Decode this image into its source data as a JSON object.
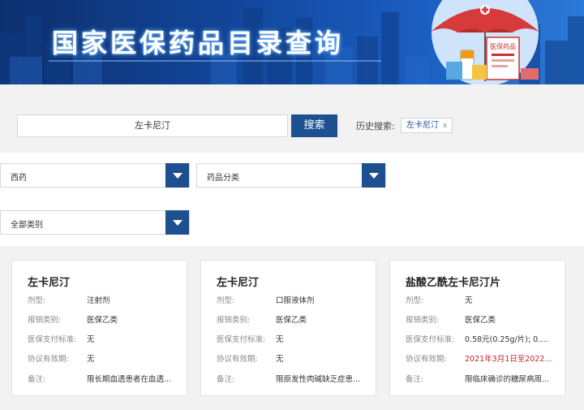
{
  "banner": {
    "title": "国家医保药品目录查询",
    "illustration_sign": "医保药品"
  },
  "search": {
    "value": "左卡尼汀",
    "button_label": "搜索",
    "history_label": "历史搜索:",
    "history_tags": [
      {
        "label": "左卡尼汀",
        "remove": "x"
      }
    ]
  },
  "filters": {
    "type_value": "西药",
    "category_value": "药品分类",
    "class_value": "全部类别"
  },
  "cards": [
    {
      "name": "左卡尼汀",
      "rows": [
        {
          "k": "剂型:",
          "v": "注射剂"
        },
        {
          "k": "报销类别:",
          "v": "医保乙类"
        },
        {
          "k": "医保支付标准:",
          "v": "无"
        },
        {
          "k": "协议有效期:",
          "v": "无"
        },
        {
          "k": "备注:",
          "v": "限长期血透患者在血透..."
        }
      ]
    },
    {
      "name": "左卡尼汀",
      "rows": [
        {
          "k": "剂型:",
          "v": "口服液体剂"
        },
        {
          "k": "报销类别:",
          "v": "医保乙类"
        },
        {
          "k": "医保支付标准:",
          "v": "无"
        },
        {
          "k": "协议有效期:",
          "v": "无"
        },
        {
          "k": "备注:",
          "v": "限原发性肉碱缺乏症患..."
        }
      ]
    },
    {
      "name": "盐酸乙酰左卡尼汀片",
      "rows": [
        {
          "k": "剂型:",
          "v": "无"
        },
        {
          "k": "报销类别:",
          "v": "医保乙类"
        },
        {
          "k": "医保支付标准:",
          "v": "0.58元(0.25g/片); 0.9..."
        },
        {
          "k": "协议有效期:",
          "v": "2021年3月1日至2022..."
        },
        {
          "k": "备注:",
          "v": "限临床确诊的糖尿病周..."
        }
      ]
    }
  ],
  "colors": {
    "primary": "#1d4f91",
    "expiry_red": "#c0282d",
    "banner_dark": "#0d2f6e"
  }
}
